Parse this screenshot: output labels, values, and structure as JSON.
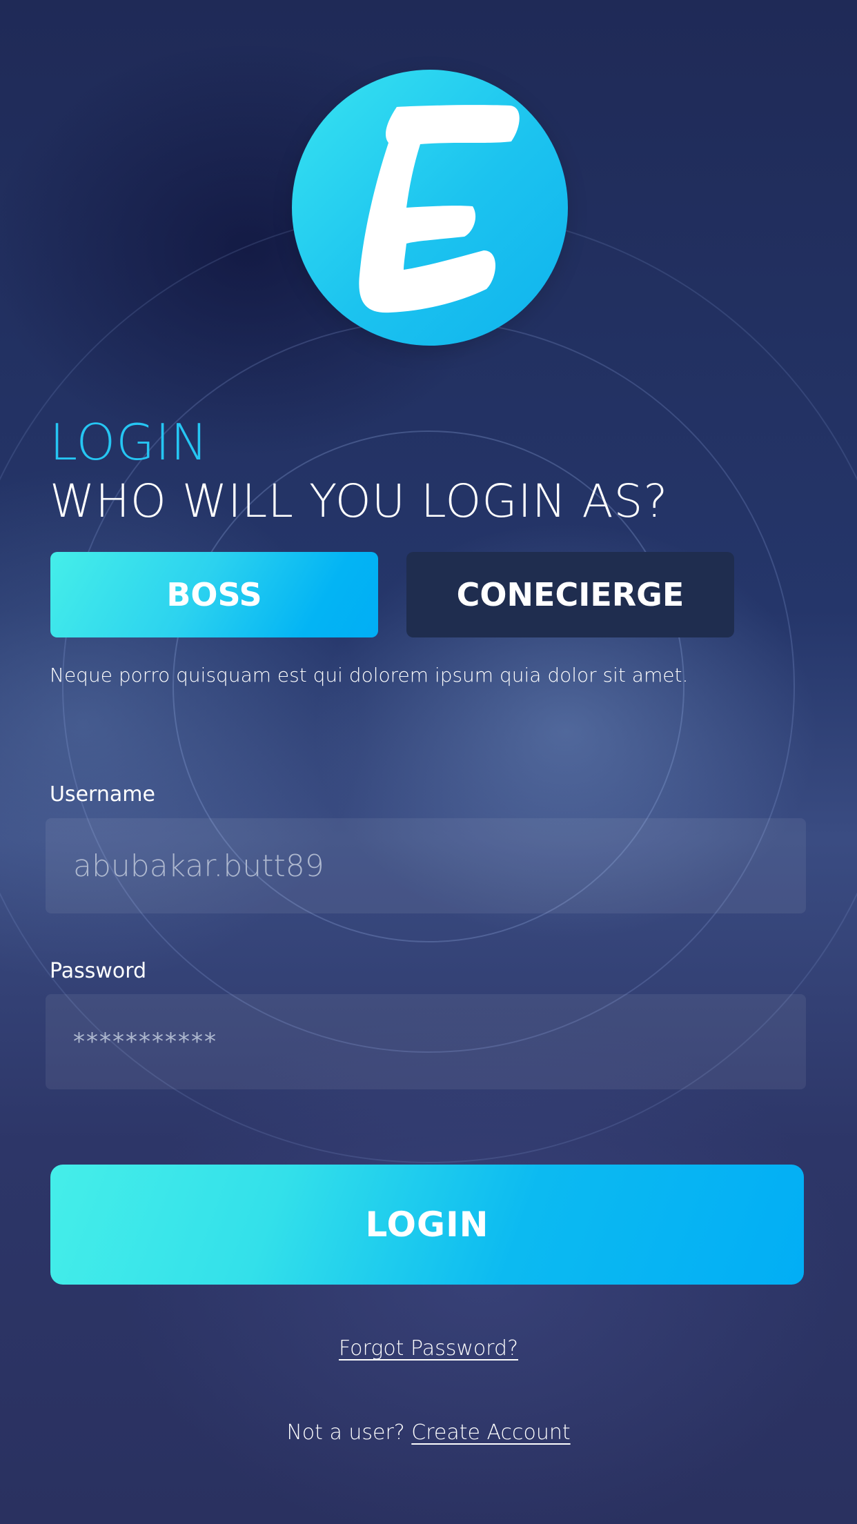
{
  "logo": {
    "letter": "E",
    "color": "#1cc3ef"
  },
  "header": {
    "subtitle": "LOGIN",
    "title": "WHO WILL YOU LOGIN AS?"
  },
  "roles": {
    "boss_label": "BOSS",
    "concierge_label": "CONECIERGE",
    "selected": "BOSS"
  },
  "description": "Neque porro quisquam est qui dolorem ipsum quia dolor sit amet.",
  "form": {
    "username_label": "Username",
    "username_value": "abubakar.butt89",
    "password_label": "Password",
    "password_value": "***********",
    "submit_label": "LOGIN"
  },
  "links": {
    "forgot_password": "Forgot Password?",
    "signup_prompt": "Not a user?",
    "signup_link": "Create Account"
  },
  "colors": {
    "accent": "#26c6f3",
    "button_gradient_start": "#45eee9",
    "button_gradient_end": "#02aef5",
    "concierge_bg": "#1f2d4f"
  }
}
